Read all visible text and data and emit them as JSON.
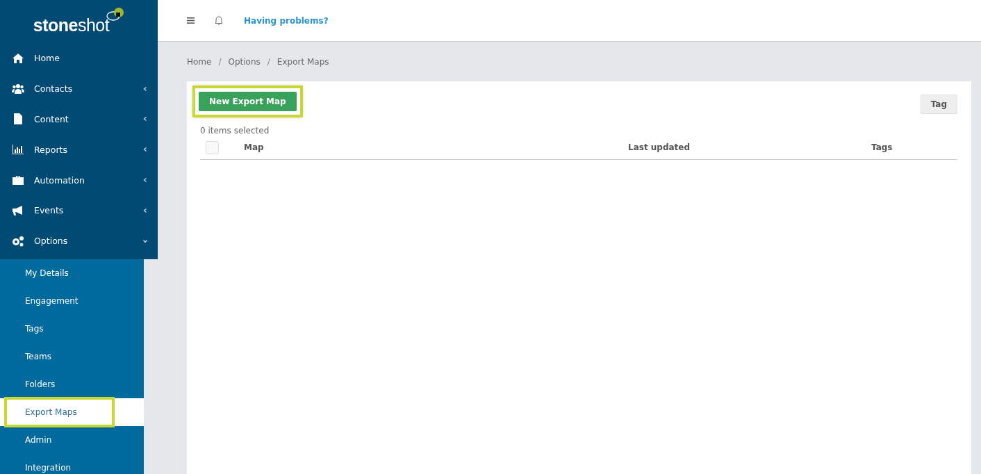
{
  "logo": {
    "text": "**stone**shot"
  },
  "topbar": {
    "help_link": "Having problems?"
  },
  "sidebar": {
    "items": [
      {
        "label": "Home"
      },
      {
        "label": "Contacts",
        "expanded": false
      },
      {
        "label": "Content",
        "expanded": false
      },
      {
        "label": "Reports",
        "expanded": false
      },
      {
        "label": "Automation",
        "expanded": false
      },
      {
        "label": "Events",
        "expanded": false
      },
      {
        "label": "Options",
        "expanded": true
      }
    ],
    "submenu": [
      {
        "label": "My Details",
        "selected": false,
        "highlighted": false
      },
      {
        "label": "Engagement",
        "selected": false,
        "highlighted": false
      },
      {
        "label": "Tags",
        "selected": false,
        "highlighted": false
      },
      {
        "label": "Teams",
        "selected": false,
        "highlighted": false
      },
      {
        "label": "Folders",
        "selected": false,
        "highlighted": false
      },
      {
        "label": "Export Maps",
        "selected": true,
        "highlighted": true
      },
      {
        "label": "Admin",
        "selected": false,
        "highlighted": false
      },
      {
        "label": "Integration",
        "selected": false,
        "highlighted": false
      }
    ]
  },
  "breadcrumb": [
    {
      "kind": "link",
      "text": "Home"
    },
    {
      "kind": "separator",
      "text": "/"
    },
    {
      "kind": "link",
      "text": "Options"
    },
    {
      "kind": "separator",
      "text": "/"
    },
    {
      "kind": "link",
      "text": "Export Maps"
    }
  ],
  "toolbar": {
    "primary_button": {
      "label": "New Export Map",
      "highlighted": true
    },
    "tag_button": "Tag"
  },
  "selection_count": "0 items selected",
  "table": {
    "select_all_checked": false,
    "columns": [
      "Map",
      "Last updated",
      "Tags"
    ]
  }
}
